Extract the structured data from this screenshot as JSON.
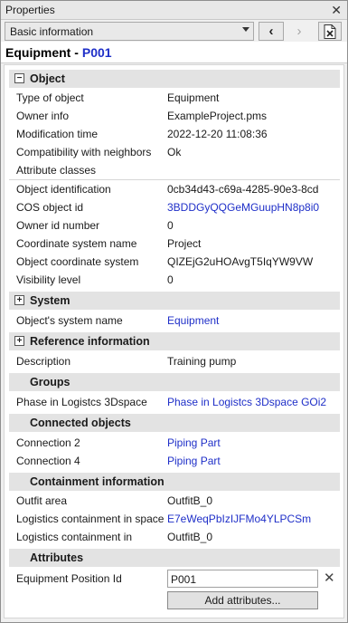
{
  "window": {
    "title": "Properties",
    "close_glyph": "✕"
  },
  "toolbar": {
    "view_selected": "Basic information",
    "back_glyph": "‹",
    "forward_glyph": "›",
    "excel_icon": "excel-export-icon"
  },
  "header": {
    "type": "Equipment -",
    "id": "P001"
  },
  "object": {
    "title": "Object",
    "toggle": "−",
    "rows": [
      {
        "label": "Type of object",
        "value": "Equipment"
      },
      {
        "label": "Owner info",
        "value": "ExampleProject.pms"
      },
      {
        "label": "Modification time",
        "value": "2022-12-20 11:08:36"
      },
      {
        "label": "Compatibility with neighbors",
        "value": "Ok"
      },
      {
        "label": "Attribute classes",
        "value": ""
      },
      {
        "label": "Object identification",
        "value": "0cb34d43-c69a-4285-90e3-8cd"
      },
      {
        "label": "COS object id",
        "value": "3BDDGyQQGeMGuupHN8p8i0"
      },
      {
        "label": "Owner id number",
        "value": "0"
      },
      {
        "label": "Coordinate system name",
        "value": "Project"
      },
      {
        "label": "Object coordinate system",
        "value": "QIZEjG2uHOAvgT5IqYW9VW"
      },
      {
        "label": "Visibility level",
        "value": "0"
      }
    ]
  },
  "system": {
    "title": "System",
    "toggle": "+",
    "rows": [
      {
        "label": "Object's system name",
        "value": "Equipment"
      }
    ]
  },
  "reference": {
    "title": "Reference information",
    "toggle": "+",
    "rows": [
      {
        "label": "Description",
        "value": "Training pump"
      }
    ]
  },
  "groups": {
    "title": "Groups",
    "rows": [
      {
        "label": "Phase in Logistcs 3Dspace",
        "value": "Phase in Logistcs 3Dspace GOi2"
      }
    ]
  },
  "connected": {
    "title": "Connected objects",
    "rows": [
      {
        "label": "Connection 2",
        "value": "Piping Part"
      },
      {
        "label": "Connection 4",
        "value": "Piping Part"
      }
    ]
  },
  "containment": {
    "title": "Containment information",
    "rows": [
      {
        "label": "Outfit area",
        "value": "OutfitB_0"
      },
      {
        "label": "Logistics containment in space",
        "value": "E7eWeqPbIzIJFMo4YLPCSm"
      },
      {
        "label": "Logistics containment in",
        "value": "OutfitB_0"
      }
    ]
  },
  "attributes": {
    "title": "Attributes",
    "field_label": "Equipment Position Id",
    "field_value": "P001",
    "clear_glyph": "✕",
    "add_label": "Add attributes..."
  },
  "colors": {
    "link": "#1f2fc8",
    "section_bg": "#e3e3e3"
  }
}
